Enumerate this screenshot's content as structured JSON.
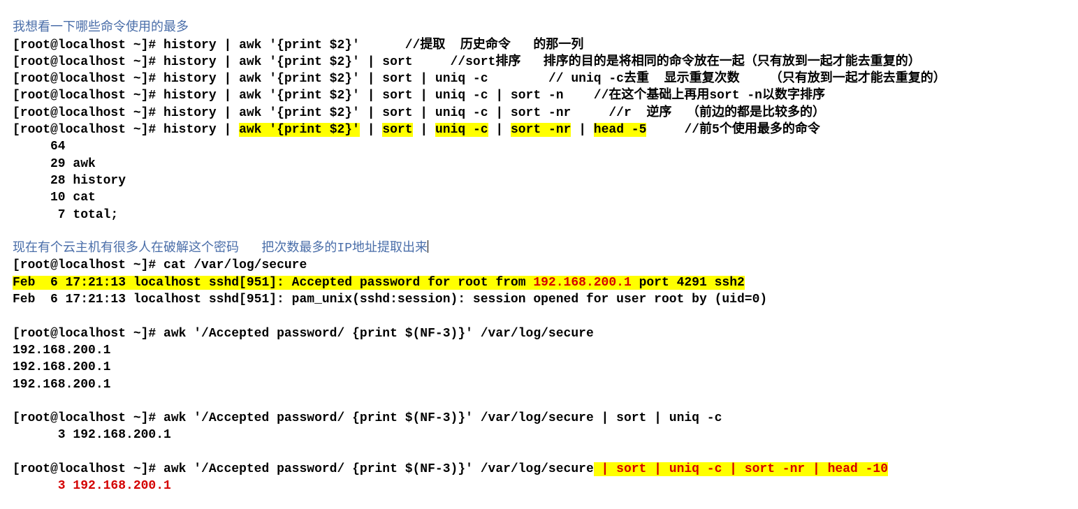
{
  "heading1": "我想看一下哪些命令使用的最多",
  "prompt": "[root@localhost ~]# ",
  "l1": {
    "cmd": "history | awk '{print $2}'",
    "cm": "//提取  历史命令   的那一列"
  },
  "l2": {
    "cmd": "history | awk '{print $2}' | sort",
    "cm": "//sort排序   排序的目的是将相同的命令放在一起（只有放到一起才能去重复的）"
  },
  "l3": {
    "cmd": "history | awk '{print $2}' | sort | uniq -c",
    "cm": "// uniq -c去重  显示重复次数    （只有放到一起才能去重复的）"
  },
  "l4": {
    "cmd": "history | awk '{print $2}' | sort | uniq -c | sort -n",
    "cm": "//在这个基础上再用sort -n以数字排序"
  },
  "l5": {
    "cmd": "history | awk '{print $2}' | sort | uniq -c | sort -nr",
    "cm": "//r  逆序  （前边的都是比较多的）"
  },
  "l6": {
    "pre": "history | ",
    "p1": "awk '{print $2}'",
    "s1": " | ",
    "p2": "sort",
    "s2": " | ",
    "p3": "uniq -c",
    "s3": " | ",
    "p4": "sort -nr",
    "s4": " | ",
    "p5": "head -5",
    "cm": "//前5个使用最多的命令"
  },
  "hist_out": [
    "     64",
    "     29 awk",
    "     28 history",
    "     10 cat",
    "      7 total;"
  ],
  "heading2": "现在有个云主机有很多人在破解这个密码   把次数最多的IP地址提取出来",
  "cat_cmd": "cat /var/log/secure",
  "sec1": {
    "a": "Feb  6 17:21:13 localhost sshd[951]: Accepted password for root from ",
    "ip": "192.168.200.1",
    "b": " port 4291 ssh2"
  },
  "sec2": "Feb  6 17:21:13 localhost sshd[951]: pam_unix(sshd:session): session opened for user root by (uid=0)",
  "awk1": {
    "cmd": "awk '/Accepted password/ {print $(NF-3)}' /var/log/secure"
  },
  "awk1_out": [
    "192.168.200.1",
    "192.168.200.1",
    "192.168.200.1"
  ],
  "awk2": {
    "cmd": "awk '/Accepted password/ {print $(NF-3)}' /var/log/secure | sort | uniq -c"
  },
  "awk2_out": "      3 192.168.200.1",
  "awk3": {
    "pre": "awk '/Accepted password/ {print $(NF-3)}' /var/log/secure",
    "tail": " | sort | uniq -c | sort -nr | head -10"
  },
  "awk3_out": "      3 192.168.200.1",
  "gap_l1": "      ",
  "gap_l2": "     ",
  "gap_l3": "        ",
  "gap_l4": "    ",
  "gap_l5": "     ",
  "gap_l6": "     "
}
